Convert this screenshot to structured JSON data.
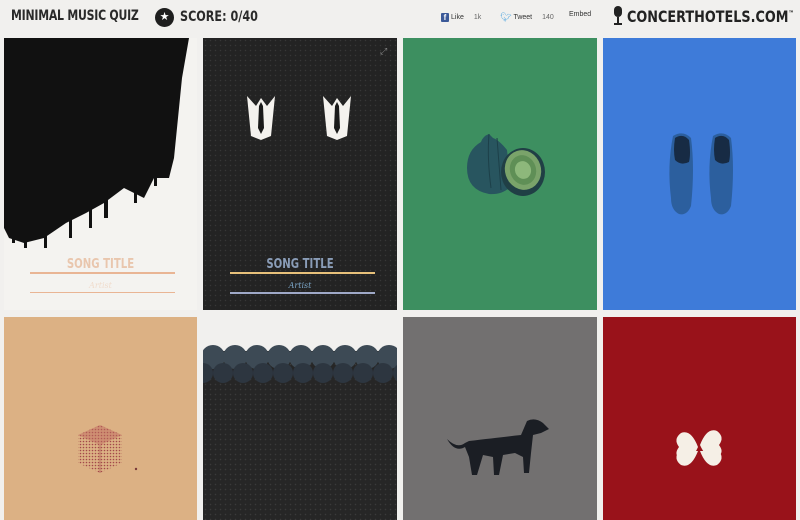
{
  "header": {
    "app_title": "MINIMAL MUSIC QUIZ",
    "score_icon": "star-icon",
    "score_text": "SCORE: 0/40",
    "facebook": {
      "label": "Like",
      "count": "1k"
    },
    "twitter": {
      "label": "Tweet",
      "count": "140"
    },
    "embed_label": "Embed",
    "brand": {
      "icon": "microphone-icon",
      "name": "CONCERTHOTELS.COM",
      "mark": "™"
    }
  },
  "cards": [
    {
      "art": "city-skyline-dripping",
      "song_title": "SONG TITLE",
      "artist": "Artist",
      "bg": "#f4f3f0"
    },
    {
      "art": "suits-and-ties",
      "song_title": "SONG TITLE",
      "artist": "Artist",
      "bg": "#232323",
      "expand_icon": "expand-icon"
    },
    {
      "art": "onion-cut",
      "bg": "#3d8f60"
    },
    {
      "art": "pair-of-shoes",
      "bg": "#3e7bd9"
    },
    {
      "art": "dotted-cube",
      "bg": "#dcb184"
    },
    {
      "art": "clouds-waves",
      "bg": "#262626"
    },
    {
      "art": "black-dog",
      "bg": "#727070"
    },
    {
      "art": "four-leaf-clover",
      "bg": "#99121a"
    }
  ]
}
